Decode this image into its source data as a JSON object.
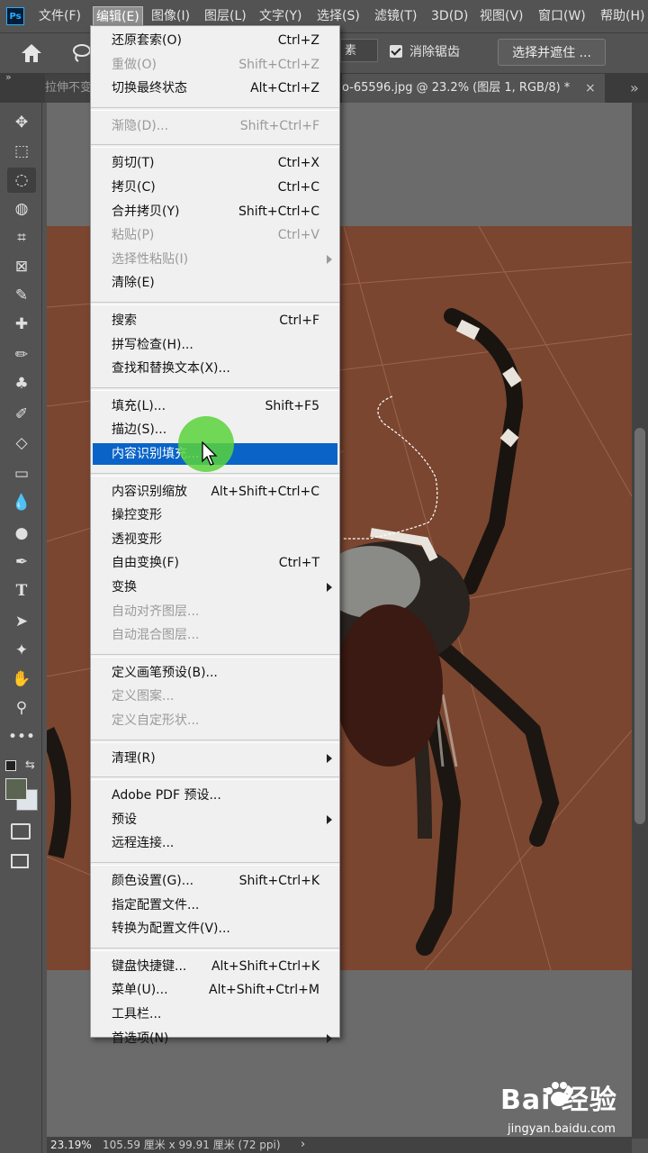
{
  "menubar": {
    "logo": "Ps",
    "items": [
      "文件(F)",
      "编辑(E)",
      "图像(I)",
      "图层(L)",
      "文字(Y)",
      "选择(S)",
      "滤镜(T)",
      "3D(D)",
      "视图(V)",
      "窗口(W)",
      "帮助(H)"
    ]
  },
  "options": {
    "feather_partial": "素",
    "anti_alias_label": "消除锯齿",
    "anti_alias_checked": true,
    "select_mask_label": "选择并遮住 ..."
  },
  "tabs": {
    "left_tab": "拉伸不变",
    "active_tab": "o-65596.jpg @ 23.2% (图层 1, RGB/8) *",
    "close": "×"
  },
  "edit_menu": {
    "items": [
      {
        "label": "还原套索(O)",
        "shortcut": "Ctrl+Z",
        "disabled": false
      },
      {
        "label": "重做(O)",
        "shortcut": "Shift+Ctrl+Z",
        "disabled": true
      },
      {
        "label": "切换最终状态",
        "shortcut": "Alt+Ctrl+Z",
        "disabled": false
      },
      {
        "sep": true
      },
      {
        "label": "渐隐(D)...",
        "shortcut": "Shift+Ctrl+F",
        "disabled": true
      },
      {
        "sep": true
      },
      {
        "label": "剪切(T)",
        "shortcut": "Ctrl+X",
        "disabled": false
      },
      {
        "label": "拷贝(C)",
        "shortcut": "Ctrl+C",
        "disabled": false
      },
      {
        "label": "合并拷贝(Y)",
        "shortcut": "Shift+Ctrl+C",
        "disabled": false
      },
      {
        "label": "粘贴(P)",
        "shortcut": "Ctrl+V",
        "disabled": true
      },
      {
        "label": "选择性粘贴(I)",
        "shortcut": "",
        "disabled": true,
        "submenu": true
      },
      {
        "label": "清除(E)",
        "shortcut": "",
        "disabled": false
      },
      {
        "sep": true
      },
      {
        "label": "搜索",
        "shortcut": "Ctrl+F",
        "disabled": false
      },
      {
        "label": "拼写检查(H)...",
        "shortcut": "",
        "disabled": false
      },
      {
        "label": "查找和替换文本(X)...",
        "shortcut": "",
        "disabled": false
      },
      {
        "sep": true
      },
      {
        "label": "填充(L)...",
        "shortcut": "Shift+F5",
        "disabled": false
      },
      {
        "label": "描边(S)...",
        "shortcut": "",
        "disabled": false
      },
      {
        "label": "内容识别填充...",
        "shortcut": "",
        "disabled": false,
        "highlighted": true
      },
      {
        "sep": true
      },
      {
        "label": "内容识别缩放",
        "shortcut": "Alt+Shift+Ctrl+C",
        "disabled": false
      },
      {
        "label": "操控变形",
        "shortcut": "",
        "disabled": false
      },
      {
        "label": "透视变形",
        "shortcut": "",
        "disabled": false
      },
      {
        "label": "自由变换(F)",
        "shortcut": "Ctrl+T",
        "disabled": false
      },
      {
        "label": "变换",
        "shortcut": "",
        "disabled": false,
        "submenu": true
      },
      {
        "label": "自动对齐图层...",
        "shortcut": "",
        "disabled": true
      },
      {
        "label": "自动混合图层...",
        "shortcut": "",
        "disabled": true
      },
      {
        "sep": true
      },
      {
        "label": "定义画笔预设(B)...",
        "shortcut": "",
        "disabled": false
      },
      {
        "label": "定义图案...",
        "shortcut": "",
        "disabled": true
      },
      {
        "label": "定义自定形状...",
        "shortcut": "",
        "disabled": true
      },
      {
        "sep": true
      },
      {
        "label": "清理(R)",
        "shortcut": "",
        "disabled": false,
        "submenu": true
      },
      {
        "sep": true
      },
      {
        "label": "Adobe PDF 预设...",
        "shortcut": "",
        "disabled": false
      },
      {
        "label": "预设",
        "shortcut": "",
        "disabled": false,
        "submenu": true
      },
      {
        "label": "远程连接...",
        "shortcut": "",
        "disabled": false
      },
      {
        "sep": true
      },
      {
        "label": "颜色设置(G)...",
        "shortcut": "Shift+Ctrl+K",
        "disabled": false
      },
      {
        "label": "指定配置文件...",
        "shortcut": "",
        "disabled": false
      },
      {
        "label": "转换为配置文件(V)...",
        "shortcut": "",
        "disabled": false
      },
      {
        "sep": true
      },
      {
        "label": "键盘快捷键...",
        "shortcut": "Alt+Shift+Ctrl+K",
        "disabled": false
      },
      {
        "label": "菜单(U)...",
        "shortcut": "Alt+Shift+Ctrl+M",
        "disabled": false
      },
      {
        "label": "工具栏...",
        "shortcut": "",
        "disabled": false
      },
      {
        "label": "首选项(N)",
        "shortcut": "",
        "disabled": false,
        "submenu": true
      }
    ]
  },
  "status": {
    "zoom": "23.19%",
    "doc_size": "105.59 厘米 x 99.91 厘米 (72 ppi)",
    "arrow": "›"
  },
  "watermark": {
    "logo": "Bai  经验",
    "url": "jingyan.baidu.com"
  },
  "colors": {
    "menu_highlight": "#0a64c8",
    "photo_background": "#7a4630",
    "foreground_swatch": "#5a6450",
    "background_swatch": "#dfe3ea",
    "click_halo": "#5ad23c"
  },
  "tools": [
    "move-icon",
    "marquee-icon",
    "lasso-icon",
    "quick-select-icon",
    "crop-icon",
    "frame-icon",
    "eyedropper-icon",
    "healing-icon",
    "brush-icon",
    "stamp-icon",
    "history-brush-icon",
    "eraser-icon",
    "gradient-icon",
    "blur-icon",
    "dodge-icon",
    "pen-icon",
    "type-icon",
    "path-select-icon",
    "shape-icon",
    "hand-icon",
    "zoom-icon",
    "more-tools-icon"
  ]
}
